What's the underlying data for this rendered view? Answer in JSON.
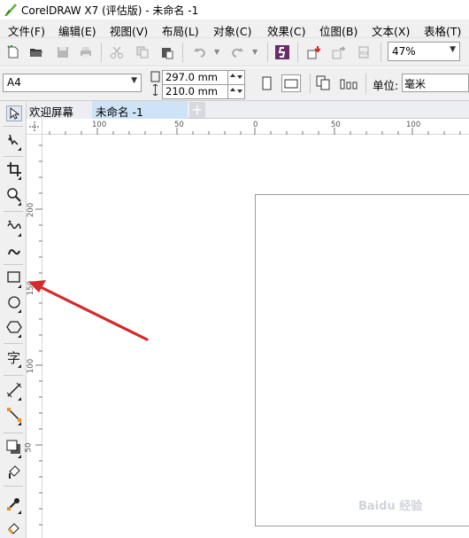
{
  "window": {
    "title": "CorelDRAW X7 (评估版) - 未命名 -1"
  },
  "menu": [
    {
      "label": "文件(F)"
    },
    {
      "label": "编辑(E)"
    },
    {
      "label": "视图(V)"
    },
    {
      "label": "布局(L)"
    },
    {
      "label": "对象(C)"
    },
    {
      "label": "效果(C)"
    },
    {
      "label": "位图(B)"
    },
    {
      "label": "文本(X)"
    },
    {
      "label": "表格(T)"
    }
  ],
  "toolbar": {
    "zoom_value": "47%",
    "icons": [
      "new-icon",
      "open-icon",
      "save-icon",
      "print-icon",
      "cut-icon",
      "copy-icon",
      "paste-icon",
      "undo-icon",
      "redo-icon",
      "corel-connect-icon",
      "import-icon",
      "export-icon",
      "publish-pdf-icon"
    ]
  },
  "property_bar": {
    "page_size": "A4",
    "width": "297.0 mm",
    "height": "210.0 mm",
    "unit_label": "单位:",
    "unit_value": "毫米"
  },
  "tabs": [
    {
      "label": "欢迎屏幕",
      "active": false
    },
    {
      "label": "未命名 -1",
      "active": true
    }
  ],
  "ruler": {
    "horizontal_labels": [
      "100",
      "50",
      "0",
      "50",
      "100"
    ],
    "vertical_labels": [
      "200",
      "150",
      "100",
      "50"
    ]
  },
  "colors": {
    "arrow": "#d42a2a",
    "active_tab": "#cfe3f6",
    "chrome": "#f0f0f0"
  },
  "watermark": "Baidu 经验"
}
